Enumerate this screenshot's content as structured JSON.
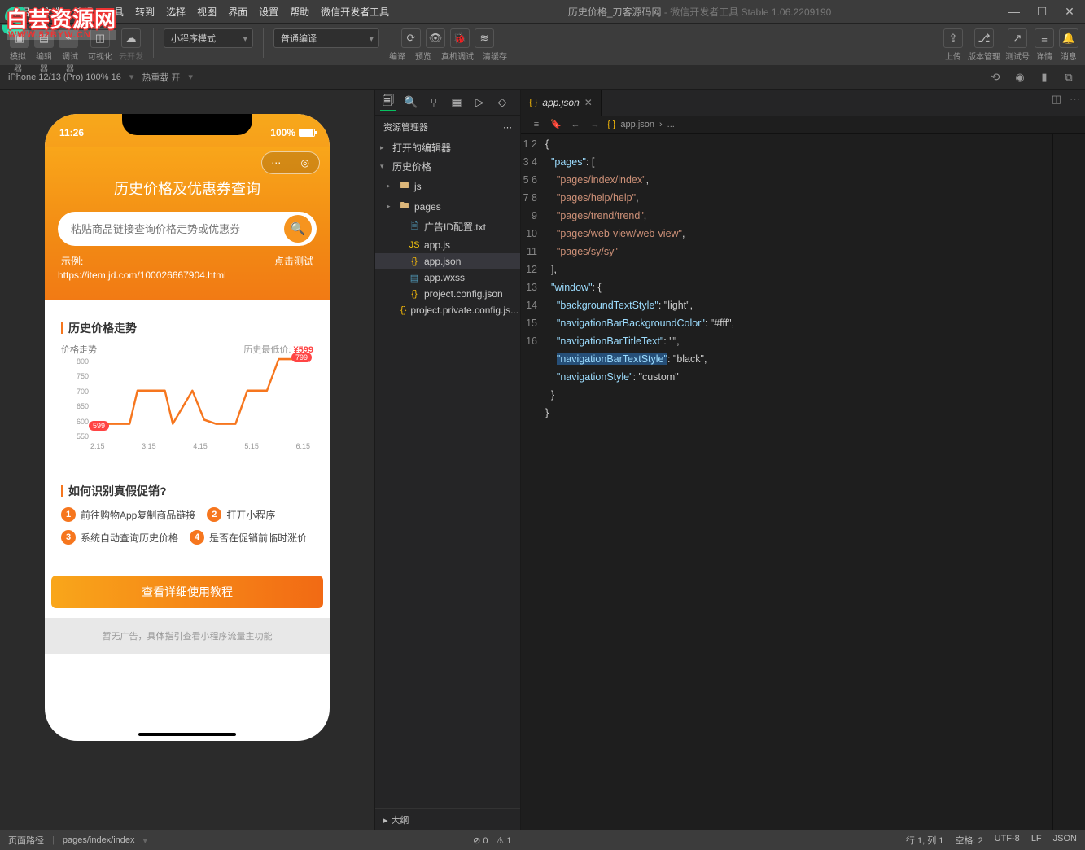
{
  "menu": [
    "项目",
    "文件",
    "编辑",
    "工具",
    "转到",
    "选择",
    "视图",
    "界面",
    "设置",
    "帮助",
    "微信开发者工具"
  ],
  "title": "历史价格_刀客源码网",
  "title_suffix": " - 微信开发者工具 Stable 1.06.2209190",
  "watermark": {
    "cn": "白芸资源网",
    "en": "WWW.52BYW.CN"
  },
  "toolbar": {
    "group1_labels": [
      "模拟器",
      "编辑器",
      "调试器",
      "可视化",
      "云开发"
    ],
    "mode": "小程序模式",
    "compile": "普通编译",
    "action_labels": [
      "编译",
      "预览",
      "真机调试",
      "清缓存"
    ],
    "right_labels": [
      "上传",
      "版本管理",
      "测试号",
      "详情",
      "消息"
    ]
  },
  "devicebar": {
    "device": "iPhone 12/13 (Pro) 100% 16",
    "reload": "热重载 开"
  },
  "phone": {
    "time": "11:26",
    "battery": "100%",
    "title": "历史价格及优惠券查询",
    "placeholder": "粘贴商品链接查询价格走势或优惠券",
    "example_label": "示例:",
    "test_label": "点击测试",
    "example_url": "https://item.jd.com/100026667904.html",
    "card1_title": "历史价格走势",
    "trend_label": "价格走势",
    "low_label": "历史最低价:",
    "low_price": "¥599",
    "card2_title": "如何识别真假促销?",
    "steps": [
      "前往购物App复制商品链接",
      "打开小程序",
      "系统自动查询历史价格",
      "是否在促销前临时涨价"
    ],
    "cta": "查看详细使用教程",
    "ad": "暂无广告，具体指引查看小程序流量主功能"
  },
  "chart_data": {
    "type": "line",
    "title": "价格走势",
    "ylabel": "",
    "xlabel": "",
    "ylim": [
      550,
      800
    ],
    "y_ticks": [
      550,
      600,
      650,
      700,
      750,
      800
    ],
    "categories": [
      "2.15",
      "3.15",
      "4.15",
      "5.15",
      "6.15"
    ],
    "values": [
      599,
      600,
      700,
      600,
      700,
      620,
      600,
      700,
      799,
      799
    ],
    "annotations": [
      {
        "label": "599",
        "x": 0,
        "y": 599
      },
      {
        "label": "799",
        "x": 9,
        "y": 799
      }
    ]
  },
  "explorer": {
    "header": "资源管理器",
    "sections": {
      "open_editors": "打开的编辑器",
      "project": "历史价格"
    },
    "tree": [
      {
        "name": "js",
        "type": "folder"
      },
      {
        "name": "pages",
        "type": "folder"
      },
      {
        "name": "广告ID配置.txt",
        "type": "txt"
      },
      {
        "name": "app.js",
        "type": "js"
      },
      {
        "name": "app.json",
        "type": "json",
        "selected": true
      },
      {
        "name": "app.wxss",
        "type": "wxss"
      },
      {
        "name": "project.config.json",
        "type": "json"
      },
      {
        "name": "project.private.config.js...",
        "type": "json"
      }
    ],
    "outline": "大纲"
  },
  "editor": {
    "tab": "app.json",
    "breadcrumb": [
      "app.json",
      "..."
    ],
    "lines": [
      "{",
      "  \"pages\": [",
      "    \"pages/index/index\",",
      "    \"pages/help/help\",",
      "    \"pages/trend/trend\",",
      "    \"pages/web-view/web-view\",",
      "    \"pages/sy/sy\"",
      "  ],",
      "  \"window\": {",
      "    \"backgroundTextStyle\": \"light\",",
      "    \"navigationBarBackgroundColor\": \"#fff\",",
      "    \"navigationBarTitleText\": \"\",",
      "    \"navigationBarTextStyle\": \"black\",",
      "    \"navigationStyle\": \"custom\"",
      "  }",
      "}"
    ]
  },
  "status": {
    "path_label": "页面路径",
    "path": "pages/index/index",
    "errors": "⊘ 0",
    "warnings": "⚠ 1",
    "pos": "行 1, 列 1",
    "spaces": "空格: 2",
    "enc": "UTF-8",
    "eol": "LF",
    "lang": "JSON"
  }
}
